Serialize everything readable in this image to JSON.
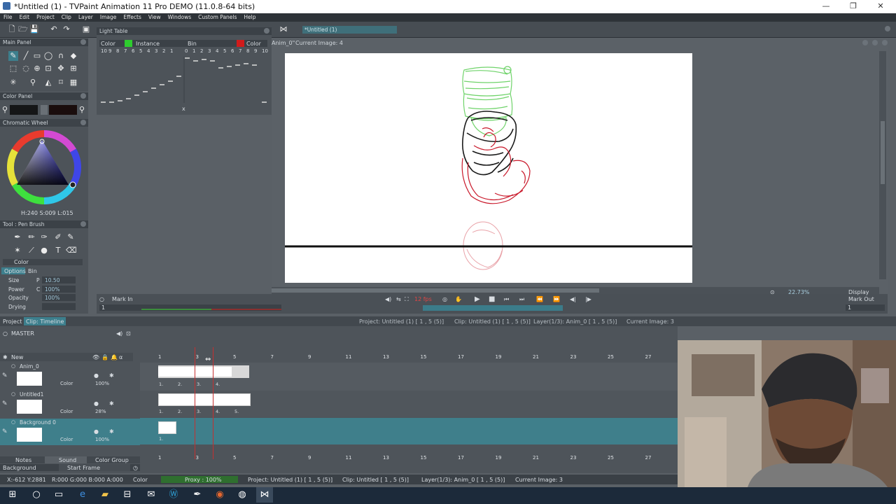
{
  "window": {
    "title": "*Untitled (1) - TVPaint Animation 11 Pro DEMO (11.0.8-64 bits)",
    "min": "—",
    "max": "❐",
    "close": "✕"
  },
  "menu": [
    "File",
    "Edit",
    "Project",
    "Clip",
    "Layer",
    "Image",
    "Effects",
    "View",
    "Windows",
    "Custom Panels",
    "Help"
  ],
  "light_table": {
    "title": "Light Table",
    "headers": [
      "Color",
      "Instance",
      "Bin",
      "Color"
    ],
    "left_nums": [
      "10",
      "9",
      "8",
      "7",
      "6",
      "5",
      "4",
      "3",
      "2",
      "1"
    ],
    "right_nums": [
      "0",
      "1",
      "2",
      "3",
      "4",
      "5",
      "6",
      "7",
      "8",
      "9",
      "10"
    ],
    "x_mark": "x"
  },
  "doc_tab": "*Untitled (1)",
  "canvas_header": {
    "anim": "Anim_0\"",
    "current": "Current Image: 4"
  },
  "main_panel": {
    "title": "Main Panel"
  },
  "color_panel": {
    "title": "Color Panel"
  },
  "chromatic": {
    "title": "Chromatic Wheel",
    "hsl": "H:240 S:009 L:015"
  },
  "tool_panel": {
    "title": "Tool : Pen Brush",
    "color_label": "Color",
    "tabs": [
      "Options",
      "Bin"
    ],
    "rows": [
      {
        "label": "Size",
        "mode": "P",
        "value": "10.50"
      },
      {
        "label": "Power",
        "mode": "C",
        "value": "100%"
      },
      {
        "label": "Opacity",
        "mode": "",
        "value": "100%"
      },
      {
        "label": "Drying",
        "mode": "",
        "value": ""
      }
    ]
  },
  "playback": {
    "mark_in": "Mark In",
    "mark_out": "Mark Out",
    "fps": "12 fps",
    "zoom": "22.73%",
    "display": "Display",
    "in_frame": "1",
    "out_frame": "1"
  },
  "info_bar": {
    "project_tab": "Project",
    "clip_tab": "Clip: Timeline",
    "project": "Project: Untitled (1) [ 1 , 5  (5)]",
    "clip": "Clip: Untitled (1) [ 1 , 5  (5)]",
    "layer": "Layer(1/3): Anim_0 [ 1 , 5  (5)]",
    "current": "Current Image: 3"
  },
  "timeline": {
    "master": "MASTER",
    "new": "New",
    "frame_numbers": [
      "1",
      "3",
      "5",
      "7",
      "9",
      "11",
      "13",
      "15",
      "17",
      "19",
      "21",
      "23",
      "25",
      "27"
    ],
    "layers": [
      {
        "name": "Anim_0",
        "mode": "Color",
        "opacity": "100%",
        "cells": [
          "1.",
          "2.",
          "3.",
          "4."
        ]
      },
      {
        "name": "Untitled1",
        "mode": "Color",
        "opacity": "28%",
        "cells": [
          "1.",
          "2.",
          "3.",
          "4.",
          "5."
        ]
      },
      {
        "name": "Background 0",
        "mode": "Color",
        "opacity": "100%",
        "cells": [
          "1."
        ]
      }
    ],
    "bottom_tabs": [
      "Notes",
      "Sound",
      "Color Group"
    ],
    "background": "Background",
    "start_frame": "Start Frame"
  },
  "status": {
    "coords": "X:-612  Y:2881",
    "rgba": "R:000 G:000 B:000 A:000",
    "color": "Color",
    "proxy": "Proxy : 100%",
    "project": "Project: Untitled (1) [ 1 , 5  (5)]",
    "clip": "Clip: Untitled [ 1 , 5  (5)]",
    "layer": "Layer(1/3): Anim_0 [ 1 , 5  (5)]",
    "current": "Current Image: 3"
  },
  "colors": {
    "accent": "#3d7f8d",
    "panel": "#4d5359",
    "dark": "#2e3338"
  }
}
